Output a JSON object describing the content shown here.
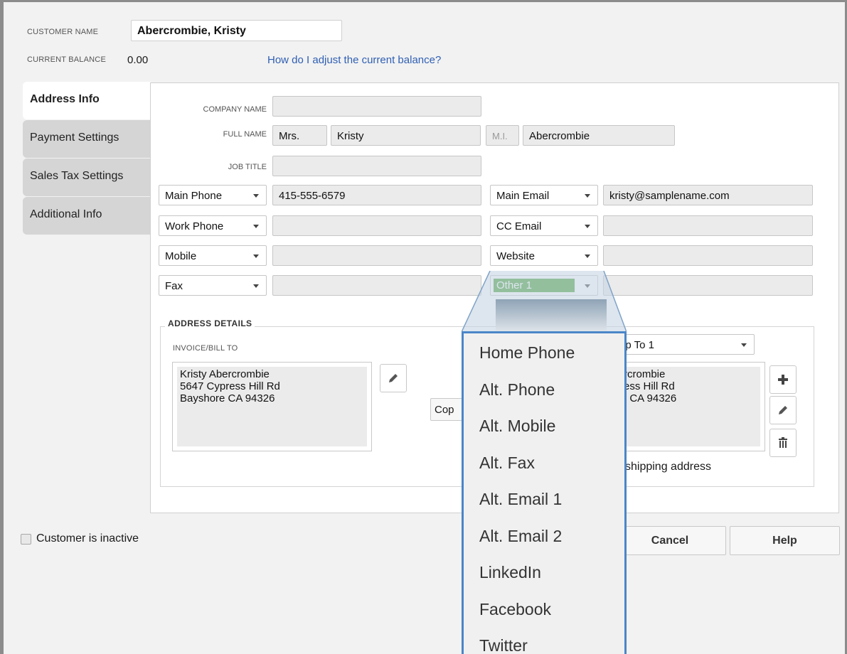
{
  "customer": {
    "name_label": "CUSTOMER NAME",
    "name_value": "Abercrombie, Kristy",
    "balance_label": "CURRENT BALANCE",
    "balance_value": "0.00",
    "adjust_link": "How do I adjust the current balance?"
  },
  "tabs": [
    {
      "label": "Address Info",
      "active": true
    },
    {
      "label": "Payment Settings",
      "active": false
    },
    {
      "label": "Sales Tax Settings",
      "active": false
    },
    {
      "label": "Additional Info",
      "active": false
    }
  ],
  "form": {
    "company_name_label": "COMPANY NAME",
    "company_name_value": "",
    "full_name_label": "FULL NAME",
    "title_value": "Mrs.",
    "first_name_value": "Kristy",
    "mi_placeholder": "M.I.",
    "last_name_value": "Abercrombie",
    "job_title_label": "JOB TITLE",
    "job_title_value": ""
  },
  "contacts_left": [
    {
      "type": "Main Phone",
      "value": "415-555-6579"
    },
    {
      "type": "Work Phone",
      "value": ""
    },
    {
      "type": "Mobile",
      "value": ""
    },
    {
      "type": "Fax",
      "value": ""
    }
  ],
  "contacts_right": [
    {
      "type": "Main Email",
      "value": "kristy@samplename.com"
    },
    {
      "type": "CC Email",
      "value": ""
    },
    {
      "type": "Website",
      "value": ""
    },
    {
      "type": "Other 1",
      "value": ""
    }
  ],
  "address": {
    "section_label": "ADDRESS DETAILS",
    "bill_to_label": "INVOICE/BILL TO",
    "bill_to_text": "Kristy Abercrombie\n5647 Cypress Hill Rd\nBayshore CA 94326",
    "ship_to_select": "ip To 1",
    "ship_to_text": "rcrombie\ness Hill Rd\n, CA 94326",
    "copy_button": "Cop",
    "default_shipping_text": "shipping address"
  },
  "popup_items": [
    "Home Phone",
    "Alt. Phone",
    "Alt. Mobile",
    "Alt. Fax",
    "Alt. Email 1",
    "Alt. Email 2",
    "LinkedIn",
    "Facebook",
    "Twitter"
  ],
  "footer": {
    "inactive_label": "Customer is inactive",
    "cancel_label": "Cancel",
    "help_label": "Help"
  },
  "colors": {
    "selected_green": "#46a035",
    "popup_border": "#4a86c8",
    "link_blue": "#2f5fb3"
  }
}
